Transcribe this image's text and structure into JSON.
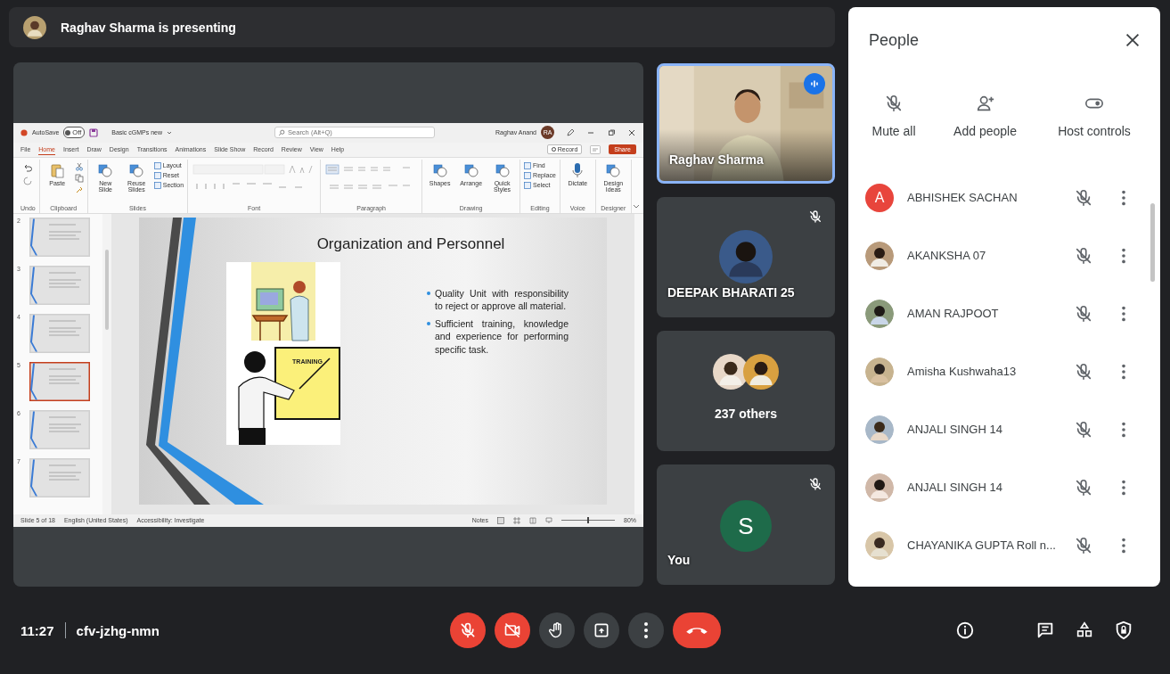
{
  "presenter_bar": {
    "text": "Raghav Sharma is presenting"
  },
  "presentation": {
    "title_bar": {
      "autosave": "AutoSave",
      "autosave_state": "Off",
      "autosave_on": false,
      "file_name": "Basic cGMPs new",
      "search_placeholder": "Search (Alt+Q)",
      "user": "Raghav Anand",
      "user_initials": "RA"
    },
    "tabs": [
      {
        "label": "File",
        "selected": false
      },
      {
        "label": "Home",
        "selected": true
      },
      {
        "label": "Insert",
        "selected": false
      },
      {
        "label": "Draw",
        "selected": false
      },
      {
        "label": "Design",
        "selected": false
      },
      {
        "label": "Transitions",
        "selected": false
      },
      {
        "label": "Animations",
        "selected": false
      },
      {
        "label": "Slide Show",
        "selected": false
      },
      {
        "label": "Record",
        "selected": false
      },
      {
        "label": "Review",
        "selected": false
      },
      {
        "label": "View",
        "selected": false
      },
      {
        "label": "Help",
        "selected": false
      }
    ],
    "record": "Record",
    "share": "Share",
    "ribbon_groups": [
      {
        "kind": "undo",
        "label": "Undo"
      },
      {
        "kind": "clipboard",
        "label": "Clipboard",
        "buttons": [
          "Paste"
        ]
      },
      {
        "kind": "slides",
        "label": "Slides",
        "buttons": [
          "New Slide",
          "Reuse Slides"
        ],
        "small_buttons": [
          "Layout",
          "Reset",
          "Section"
        ]
      },
      {
        "kind": "font",
        "label": "Font"
      },
      {
        "kind": "paragraph",
        "label": "Paragraph"
      },
      {
        "kind": "drawing",
        "label": "Drawing",
        "buttons": [
          "Shapes",
          "Arrange",
          "Quick Styles"
        ]
      },
      {
        "kind": "editing",
        "label": "Editing",
        "small_buttons": [
          "Find",
          "Replace",
          "Select"
        ]
      },
      {
        "kind": "voice",
        "label": "Voice",
        "buttons": [
          "Dictate"
        ]
      },
      {
        "kind": "designer",
        "label": "Designer",
        "buttons": [
          "Design Ideas"
        ]
      }
    ],
    "thumbnails": [
      {
        "number": "2",
        "selected": false
      },
      {
        "number": "3",
        "selected": false
      },
      {
        "number": "4",
        "selected": false
      },
      {
        "number": "5",
        "selected": true
      },
      {
        "number": "6",
        "selected": false
      },
      {
        "number": "7",
        "selected": false
      }
    ],
    "slide": {
      "title": "Organization and Personnel",
      "image_label": "TRAINING",
      "bullets": [
        "Quality Unit with responsibility to reject or approve all material.",
        "Sufficient training, knowledge and experience for performing specific task."
      ]
    },
    "status_bar": {
      "slide_count": "Slide 5 of 18",
      "language": "English (United States)",
      "accessibility": "Accessibility: Investigate",
      "notes": "Notes",
      "zoom": "80%",
      "zoom_slider": {
        "level": 0.5
      }
    }
  },
  "tiles": [
    {
      "kind": "video",
      "name": "Raghav Sharma",
      "speaking": true
    },
    {
      "kind": "avatar",
      "name": "DEEPAK BHARATI 25",
      "muted": true
    },
    {
      "kind": "group",
      "label": "237 others"
    },
    {
      "kind": "self",
      "initial": "S",
      "name": "You",
      "muted": true
    }
  ],
  "people": {
    "title": "People",
    "actions": [
      {
        "kind": "mute",
        "label": "Mute all"
      },
      {
        "kind": "add",
        "label": "Add people"
      },
      {
        "kind": "host",
        "label": "Host controls"
      }
    ],
    "participants": [
      {
        "name": "ABHISHEK SACHAN",
        "kind": "letter",
        "initial": "A",
        "color": "#e8453c",
        "muted": true
      },
      {
        "name": "AKANKSHA 07",
        "kind": "picture",
        "muted": true
      },
      {
        "name": "AMAN RAJPOOT",
        "kind": "picture",
        "muted": true
      },
      {
        "name": "Amisha Kushwaha13",
        "kind": "picture",
        "muted": true
      },
      {
        "name": "ANJALI SINGH 14",
        "kind": "picture",
        "muted": true
      },
      {
        "name": "ANJALI SINGH 14",
        "kind": "picture",
        "muted": true
      },
      {
        "name": "CHAYANIKA GUPTA Roll n...",
        "kind": "picture",
        "muted": true
      }
    ]
  },
  "meeting": {
    "time": "11:27",
    "code": "cfv-jzhg-nmn",
    "controls": [
      {
        "kind": "mic",
        "on": false
      },
      {
        "kind": "camera",
        "on": false
      },
      {
        "kind": "hand"
      },
      {
        "kind": "present"
      },
      {
        "kind": "more"
      },
      {
        "kind": "leave"
      }
    ],
    "side_buttons": [
      {
        "kind": "info"
      },
      {
        "kind": "chat"
      },
      {
        "kind": "activities"
      },
      {
        "kind": "host"
      }
    ]
  }
}
